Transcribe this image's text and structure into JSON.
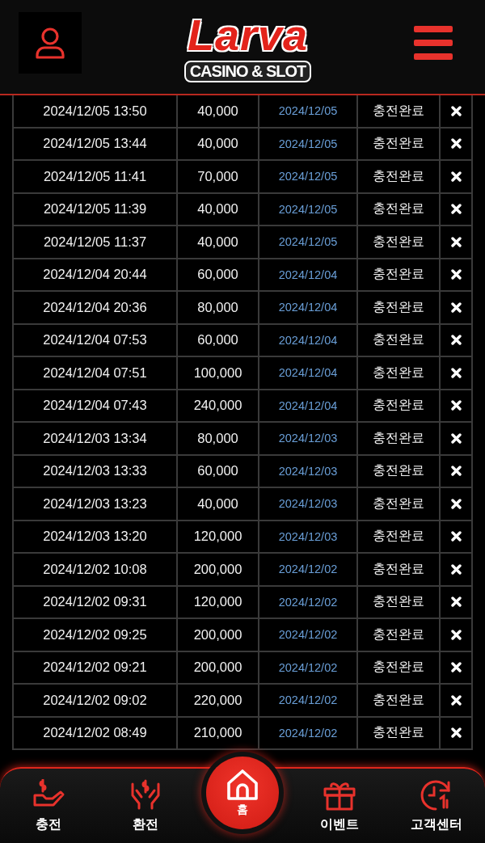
{
  "header": {
    "logo": {
      "title": "Larva",
      "subtitle": "CASINO & SLOT"
    }
  },
  "rows": [
    {
      "time": "2024/12/05 13:50",
      "amount": "40,000",
      "date": "2024/12/05",
      "status": "충전완료"
    },
    {
      "time": "2024/12/05 13:44",
      "amount": "40,000",
      "date": "2024/12/05",
      "status": "충전완료"
    },
    {
      "time": "2024/12/05 11:41",
      "amount": "70,000",
      "date": "2024/12/05",
      "status": "충전완료"
    },
    {
      "time": "2024/12/05 11:39",
      "amount": "40,000",
      "date": "2024/12/05",
      "status": "충전완료"
    },
    {
      "time": "2024/12/05 11:37",
      "amount": "40,000",
      "date": "2024/12/05",
      "status": "충전완료"
    },
    {
      "time": "2024/12/04 20:44",
      "amount": "60,000",
      "date": "2024/12/04",
      "status": "충전완료"
    },
    {
      "time": "2024/12/04 20:36",
      "amount": "80,000",
      "date": "2024/12/04",
      "status": "충전완료"
    },
    {
      "time": "2024/12/04 07:53",
      "amount": "60,000",
      "date": "2024/12/04",
      "status": "충전완료"
    },
    {
      "time": "2024/12/04 07:51",
      "amount": "100,000",
      "date": "2024/12/04",
      "status": "충전완료"
    },
    {
      "time": "2024/12/04 07:43",
      "amount": "240,000",
      "date": "2024/12/04",
      "status": "충전완료"
    },
    {
      "time": "2024/12/03 13:34",
      "amount": "80,000",
      "date": "2024/12/03",
      "status": "충전완료"
    },
    {
      "time": "2024/12/03 13:33",
      "amount": "60,000",
      "date": "2024/12/03",
      "status": "충전완료"
    },
    {
      "time": "2024/12/03 13:23",
      "amount": "40,000",
      "date": "2024/12/03",
      "status": "충전완료"
    },
    {
      "time": "2024/12/03 13:20",
      "amount": "120,000",
      "date": "2024/12/03",
      "status": "충전완료"
    },
    {
      "time": "2024/12/02 10:08",
      "amount": "200,000",
      "date": "2024/12/02",
      "status": "충전완료"
    },
    {
      "time": "2024/12/02 09:31",
      "amount": "120,000",
      "date": "2024/12/02",
      "status": "충전완료"
    },
    {
      "time": "2024/12/02 09:25",
      "amount": "200,000",
      "date": "2024/12/02",
      "status": "충전완료"
    },
    {
      "time": "2024/12/02 09:21",
      "amount": "200,000",
      "date": "2024/12/02",
      "status": "충전완료"
    },
    {
      "time": "2024/12/02 09:02",
      "amount": "220,000",
      "date": "2024/12/02",
      "status": "충전완료"
    },
    {
      "time": "2024/12/02 08:49",
      "amount": "210,000",
      "date": "2024/12/02",
      "status": "충전완료"
    }
  ],
  "bottom_nav": [
    {
      "kind": "deposit",
      "label": "충전"
    },
    {
      "kind": "withdraw",
      "label": "환전"
    },
    {
      "kind": "home",
      "label": "홈"
    },
    {
      "kind": "event",
      "label": "이벤트"
    },
    {
      "kind": "support",
      "label": "고객센터"
    }
  ]
}
